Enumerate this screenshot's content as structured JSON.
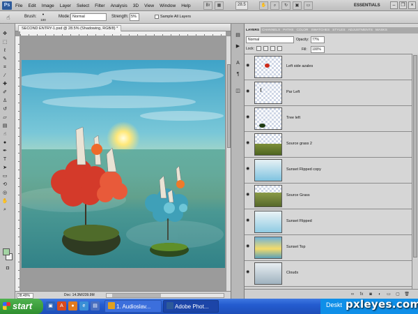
{
  "menubar": {
    "logo": "Ps",
    "items": [
      "File",
      "Edit",
      "Image",
      "Layer",
      "Select",
      "Filter",
      "Analysis",
      "3D",
      "View",
      "Window",
      "Help"
    ],
    "zoom": "28.5",
    "workspace": "ESSENTIALS"
  },
  "options": {
    "brush_label": "Brush:",
    "brush_size": "100",
    "mode_label": "Mode:",
    "mode_value": "Normal",
    "strength_label": "Strength:",
    "strength_value": "5%",
    "sample_label": "Sample All Layers"
  },
  "document": {
    "tab_label": "SECOND ENTRY-1.psd @ 28.5% (Shadowing, RGB/8) *",
    "status_zoom": "28.49%",
    "status_doc": "Doc: 14.3M/239.9M"
  },
  "layers_panel": {
    "tabs": [
      "LAYERS",
      "CHANNELS",
      "PATHS",
      "COLOR",
      "SWATCHES",
      "STYLES",
      "ADJUSTMENTS",
      "MASKS"
    ],
    "blend_mode": "Normal",
    "opacity_label": "Opacity:",
    "opacity_value": "77%",
    "lock_label": "Lock:",
    "fill_label": "Fill:",
    "fill_value": "100%",
    "layers": [
      {
        "name": "Left side azales",
        "thumb": "red-spot"
      },
      {
        "name": "Par Left",
        "thumb": "transparent"
      },
      {
        "name": "Tree left",
        "thumb": "dark-spot"
      },
      {
        "name": "Source grass 2",
        "thumb": "grass"
      },
      {
        "name": "Sunset Flipped copy",
        "thumb": "sky-flipped"
      },
      {
        "name": "Source Grass",
        "thumb": "grass"
      },
      {
        "name": "Sunset Flipped",
        "thumb": "sky-flipped"
      },
      {
        "name": "Sunset Top",
        "thumb": "sunset"
      },
      {
        "name": "Clouds",
        "thumb": "clouds"
      }
    ]
  },
  "taskbar": {
    "start_label": "start",
    "tasks": [
      "1. Audioslav...",
      "Adobe Phot..."
    ],
    "tray_text": "Deskt"
  },
  "watermark": "pxleyes.com"
}
